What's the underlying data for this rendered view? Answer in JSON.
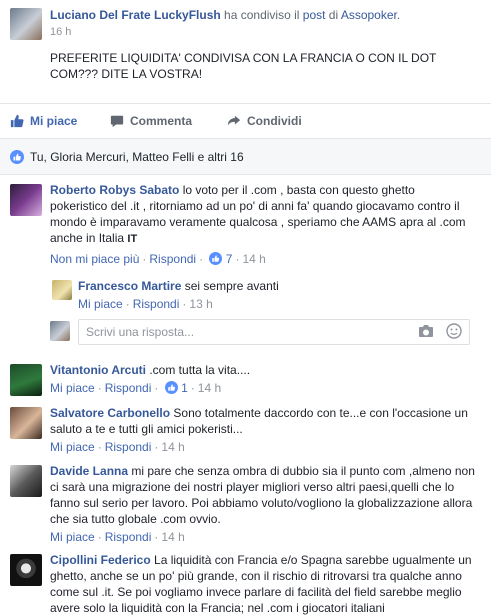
{
  "post": {
    "author": "Luciano Del Frate LuckyFlush",
    "shared_text": "ha condiviso il",
    "post_link": "post",
    "of_text": "di",
    "page": "Assopoker",
    "period": ".",
    "time": "16 h",
    "text": "PREFERITE LIQUIDITA' CONDIVISA CON LA FRANCIA O CON IL DOT COM??? DITE LA VOSTRA!"
  },
  "actions": {
    "like": "Mi piace",
    "comment": "Commenta",
    "share": "Condividi"
  },
  "likes": {
    "text": "Tu, Gloria Mercuri, Matteo Felli e altri 16"
  },
  "comments": [
    {
      "author": "Roberto Robys Sabato",
      "text": "lo voto per il .com , basta con questo ghetto pokeristico del .it , ritorniamo ad un po' di anni fa' quando giocavamo contro il mondo è imparavamo veramente qualcosa , speriamo che AAMS apra al .com anche in Italia",
      "flag": "IT",
      "unlike": "Non mi piace più",
      "reply": "Rispondi",
      "reactions": "7",
      "time": "14 h"
    },
    {
      "author": "Francesco Martire",
      "text": "sei sempre avanti",
      "like": "Mi piace",
      "reply": "Rispondi",
      "time": "13 h"
    },
    {
      "author": "Vitantonio Arcuti",
      "text": ".com tutta la vita....",
      "like": "Mi piace",
      "reply": "Rispondi",
      "reactions": "1",
      "time": "14 h"
    },
    {
      "author": "Salvatore Carbonello",
      "text": "Sono totalmente daccordo con te...e con l'occasione un saluto a te e tutti gli amici pokeristi...",
      "like": "Mi piace",
      "reply": "Rispondi",
      "time": "14 h"
    },
    {
      "author": "Davide Lanna",
      "text": "mi pare che senza ombra di dubbio sia il punto com ,almeno non ci sarà una migrazione dei nostri player migliori verso altri paesi,quelli che lo fanno sul serio per lavoro. Poi abbiamo voluto/vogliono la globalizzazione allora che sia tutto globale .com ovvio.",
      "like": "Mi piace",
      "reply": "Rispondi",
      "time": "14 h"
    },
    {
      "author": "Cipollini Federico",
      "text": "La liquidità con Francia e/o Spagna sarebbe ugualmente un ghetto, anche se un po' più grande, con il rischio di ritrovarsi tra qualche anno come sul .it. Se poi vogliamo invece parlare di facilità del field sarebbe meglio avere solo la liquidità con la Francia; nel .com i giocatori italiani"
    }
  ],
  "reply_box": {
    "placeholder": "Scrivi una risposta..."
  },
  "colors": {
    "link": "#365899",
    "accent": "#4267b2",
    "meta": "#90949c",
    "text": "#1d2129"
  }
}
